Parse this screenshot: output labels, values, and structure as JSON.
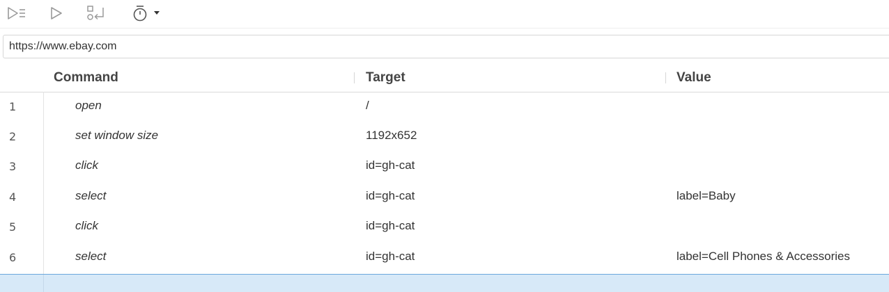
{
  "toolbar": {
    "buttons": [
      {
        "name": "run-all-tests-icon",
        "label": ""
      },
      {
        "name": "run-current-test-icon",
        "label": ""
      },
      {
        "name": "step-over-icon",
        "label": ""
      },
      {
        "name": "test-speed-icon",
        "label": ""
      }
    ]
  },
  "url": {
    "value": "https://www.ebay.com"
  },
  "table": {
    "headers": {
      "command": "Command",
      "target": "Target",
      "value": "Value"
    },
    "rows": [
      {
        "num": "1",
        "command": "open",
        "target": "/",
        "value": ""
      },
      {
        "num": "2",
        "command": "set window size",
        "target": "1192x652",
        "value": ""
      },
      {
        "num": "3",
        "command": "click",
        "target": "id=gh-cat",
        "value": ""
      },
      {
        "num": "4",
        "command": "select",
        "target": "id=gh-cat",
        "value": "label=Baby"
      },
      {
        "num": "5",
        "command": "click",
        "target": "id=gh-cat",
        "value": ""
      },
      {
        "num": "6",
        "command": "select",
        "target": "id=gh-cat",
        "value": "label=Cell Phones & Accessories"
      }
    ]
  },
  "colors": {
    "selected_row_bg": "#d7e9f8",
    "selected_row_border": "#6aa7dc",
    "icon_gray": "#9a9a9a"
  }
}
